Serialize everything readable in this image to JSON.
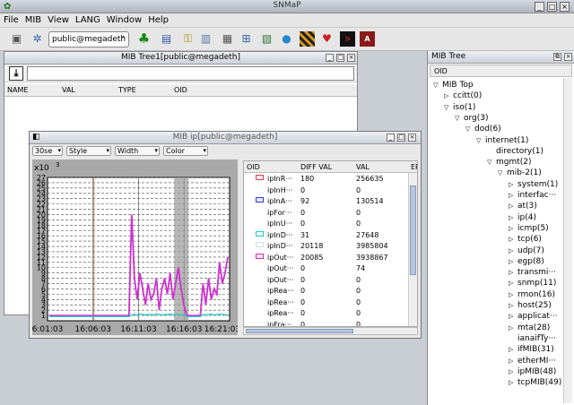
{
  "app": {
    "title": "SNMaP"
  },
  "menu": [
    "File",
    "MIB",
    "View",
    "LANG",
    "Window",
    "Help"
  ],
  "toolbar": {
    "agent": "public@megadeth"
  },
  "mib_tree1": {
    "title": "MIB Tree1[public@megadeth]",
    "columns": [
      "NAME",
      "VAL",
      "TYPE",
      "OID"
    ]
  },
  "ip_window": {
    "title": "MIB ip[public@megadeth]",
    "controls": [
      "30se",
      "Style",
      "Width",
      "Color"
    ],
    "columns": [
      "OID",
      "DIFF VAL",
      "VAL",
      "ERROR"
    ],
    "rows": [
      {
        "oid": "ipInR···",
        "diff": "180",
        "val": "256635",
        "color": "#d04060"
      },
      {
        "oid": "ipInH···",
        "diff": "0",
        "val": "0",
        "color": ""
      },
      {
        "oid": "ipInA···",
        "diff": "92",
        "val": "130514",
        "color": "#3040c0"
      },
      {
        "oid": "ipFor···",
        "diff": "0",
        "val": "0",
        "color": ""
      },
      {
        "oid": "ipInU···",
        "diff": "0",
        "val": "0",
        "color": ""
      },
      {
        "oid": "ipInD···",
        "diff": "31",
        "val": "27648",
        "color": "#30c8c8"
      },
      {
        "oid": "ipInD···",
        "diff": "20118",
        "val": "3985804",
        "color": "#d0e0f0"
      },
      {
        "oid": "ipOut···",
        "diff": "20085",
        "val": "3938867",
        "color": "#c030c0"
      },
      {
        "oid": "ipOut···",
        "diff": "0",
        "val": "74",
        "color": ""
      },
      {
        "oid": "ipOut···",
        "diff": "0",
        "val": "0",
        "color": ""
      },
      {
        "oid": "ipRea···",
        "diff": "0",
        "val": "0",
        "color": ""
      },
      {
        "oid": "ipRea···",
        "diff": "0",
        "val": "0",
        "color": ""
      },
      {
        "oid": "ipRea···",
        "diff": "0",
        "val": "0",
        "color": ""
      },
      {
        "oid": "ipFra···",
        "diff": "0",
        "val": "0",
        "color": ""
      }
    ]
  },
  "chart_data": {
    "type": "line",
    "unit_label": "x10",
    "unit_exp": "3",
    "ylim": [
      0,
      27
    ],
    "yticks": [
      "1",
      "2",
      "3",
      "4",
      "5",
      "6",
      "7",
      "8",
      "9",
      "10",
      "11",
      "12",
      "13",
      "14",
      "15",
      "16",
      "17",
      "18",
      "19",
      "20",
      "21",
      "22",
      "23",
      "24",
      "25",
      "26",
      "27"
    ],
    "xticks": [
      "6:01:03",
      "16:06:03",
      "16:11:03",
      "16:16:03",
      "16:21:03"
    ],
    "grid": true,
    "series": [
      {
        "color": "#d030d0",
        "values": [
          1,
          1,
          1,
          1,
          1,
          1,
          1,
          1,
          1,
          1,
          1,
          1,
          1,
          1,
          1,
          1,
          1,
          1,
          1,
          1,
          1,
          1,
          1,
          1,
          1,
          1,
          1,
          1,
          1,
          1,
          20,
          8,
          4,
          9,
          6,
          3,
          7,
          4,
          5,
          8,
          2,
          6,
          8,
          5,
          9,
          4,
          7,
          10,
          6,
          3,
          1,
          1,
          1,
          1,
          1,
          1,
          7,
          3,
          8,
          4,
          6,
          5,
          11,
          7,
          9,
          12
        ]
      },
      {
        "color": "#30c8c8",
        "values": [
          0.8,
          0.8,
          0.8,
          0.8,
          0.8,
          0.8,
          0.8,
          0.8,
          0.8,
          0.8,
          0.8,
          0.8,
          0.8,
          0.8,
          0.8,
          0.8,
          0.8,
          0.8,
          0.8,
          0.8,
          0.8,
          0.8,
          0.8,
          0.8,
          0.8,
          0.8,
          0.8,
          0.8,
          0.8,
          0.8,
          1.1,
          1.2,
          1.1,
          1.3,
          1.2,
          1.1,
          1.2,
          1.2,
          1.1,
          1.3,
          1.2,
          1.1,
          1.2,
          1.2,
          1.3,
          1.1,
          1.2,
          1.2,
          1.1,
          1.2,
          0.8,
          0.8,
          0.8,
          0.8,
          0.8,
          0.8,
          1.2,
          1.1,
          1.2,
          1.3,
          1.1,
          1.2,
          1.2,
          1.3,
          1.1,
          1.2
        ]
      }
    ]
  },
  "mib_tree": {
    "title": "MIB Tree",
    "column": "OID",
    "nodes": [
      {
        "label": "MIB Top",
        "depth": 0,
        "state": "open"
      },
      {
        "label": "ccitt(0)",
        "depth": 1,
        "state": "closed"
      },
      {
        "label": "iso(1)",
        "depth": 1,
        "state": "open"
      },
      {
        "label": "org(3)",
        "depth": 2,
        "state": "open"
      },
      {
        "label": "dod(6)",
        "depth": 3,
        "state": "open"
      },
      {
        "label": "internet(1)",
        "depth": 4,
        "state": "open"
      },
      {
        "label": "directory(1)",
        "depth": 5,
        "state": "leaf"
      },
      {
        "label": "mgmt(2)",
        "depth": 5,
        "state": "open"
      },
      {
        "label": "mib-2(1)",
        "depth": 6,
        "state": "open"
      },
      {
        "label": "system(1)",
        "depth": 7,
        "state": "closed"
      },
      {
        "label": "interfac···",
        "depth": 7,
        "state": "closed"
      },
      {
        "label": "at(3)",
        "depth": 7,
        "state": "closed"
      },
      {
        "label": "ip(4)",
        "depth": 7,
        "state": "closed"
      },
      {
        "label": "icmp(5)",
        "depth": 7,
        "state": "closed"
      },
      {
        "label": "tcp(6)",
        "depth": 7,
        "state": "closed"
      },
      {
        "label": "udp(7)",
        "depth": 7,
        "state": "closed"
      },
      {
        "label": "egp(8)",
        "depth": 7,
        "state": "closed"
      },
      {
        "label": "transmi···",
        "depth": 7,
        "state": "closed"
      },
      {
        "label": "snmp(11)",
        "depth": 7,
        "state": "closed"
      },
      {
        "label": "rmon(16)",
        "depth": 7,
        "state": "closed"
      },
      {
        "label": "host(25)",
        "depth": 7,
        "state": "closed"
      },
      {
        "label": "applicat···",
        "depth": 7,
        "state": "closed"
      },
      {
        "label": "mta(28)",
        "depth": 7,
        "state": "closed"
      },
      {
        "label": "ianaifTy···",
        "depth": 7,
        "state": "leaf"
      },
      {
        "label": "ifMIB(31)",
        "depth": 7,
        "state": "closed"
      },
      {
        "label": "etherMI···",
        "depth": 7,
        "state": "closed"
      },
      {
        "label": "ipMIB(48)",
        "depth": 7,
        "state": "closed"
      },
      {
        "label": "tcpMIB(49)",
        "depth": 7,
        "state": "closed"
      }
    ]
  }
}
